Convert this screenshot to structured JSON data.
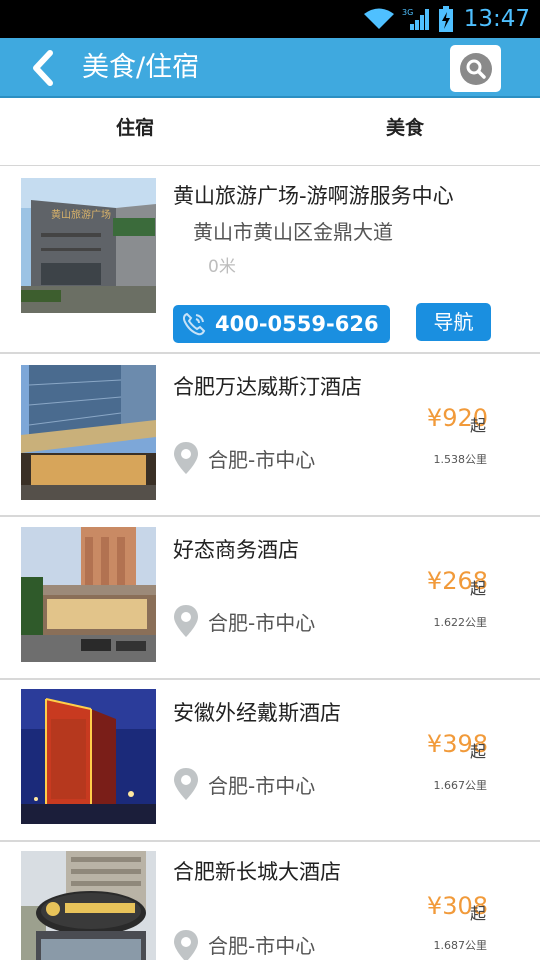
{
  "status_bar": {
    "time": "13:47",
    "network": "3G"
  },
  "header": {
    "title": "美食/住宿"
  },
  "tabs": [
    {
      "label": "住宿"
    },
    {
      "label": "美食"
    }
  ],
  "featured": {
    "name": "黄山旅游广场-游啊游服务中心",
    "address": "黄山市黄山区金鼎大道",
    "distance": "0米",
    "phone": "400-0559-626",
    "nav_label": "导航",
    "sign_text": "黄山旅游广场"
  },
  "hotels": [
    {
      "name": "合肥万达威斯汀酒店",
      "price": "¥920",
      "price_suffix": "起",
      "location": "合肥-市中心",
      "distance": "1.538公里"
    },
    {
      "name": "好态商务酒店",
      "price": "¥268",
      "price_suffix": "起",
      "location": "合肥-市中心",
      "distance": "1.622公里"
    },
    {
      "name": "安徽外经戴斯酒店",
      "price": "¥398",
      "price_suffix": "起",
      "location": "合肥-市中心",
      "distance": "1.667公里"
    },
    {
      "name": "合肥新长城大酒店",
      "price": "¥308",
      "price_suffix": "起",
      "location": "合肥-市中心",
      "distance": "1.687公里"
    }
  ],
  "colors": {
    "header": "#3fa9df",
    "button": "#1a8fe0",
    "price": "#f19a3a"
  }
}
